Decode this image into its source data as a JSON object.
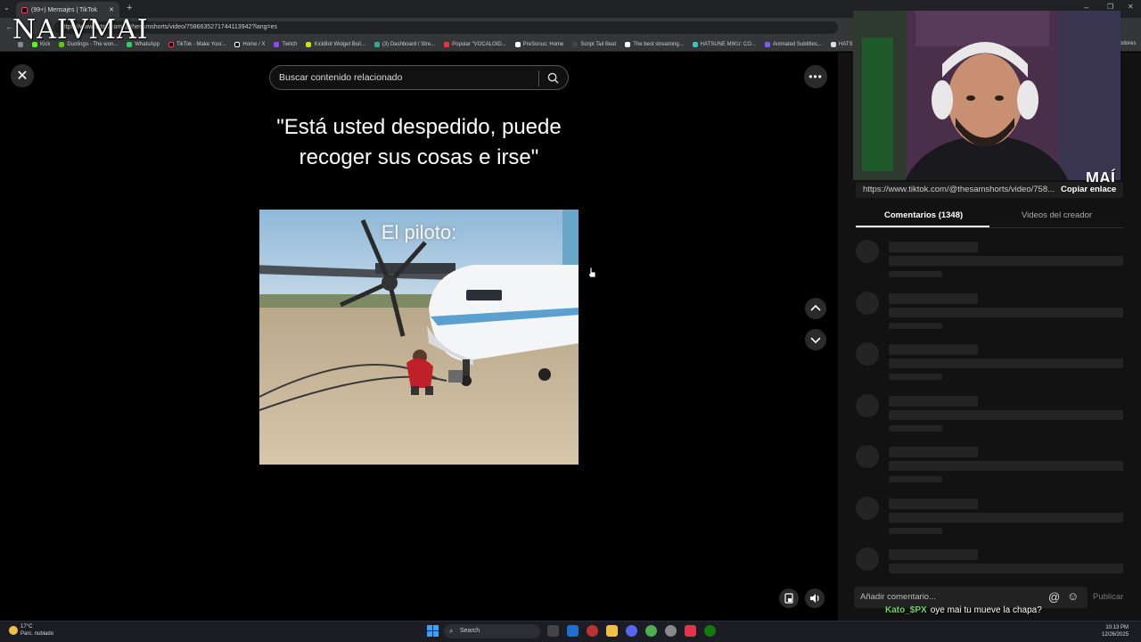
{
  "overlay_logo": "NAIVMAI",
  "browser": {
    "tab_title": "(99+) Mensajes | TikTok",
    "url": "https://www.tiktok.com/@thesamshorts/video/7586635271744113942?lang=es",
    "bookmarks": [
      "Kick",
      "Duolingo - The won...",
      "WhatsApp",
      "TikTok - Make Your...",
      "Home / X",
      "Twitch",
      "KickBot Widget Buil...",
      "(3) Dashboard / Stre...",
      "Popular \"VOCALOID...",
      "PreSonus: Home",
      "Script Tail Beat",
      "The best streaming...",
      "HATSUNE MIKU: CO...",
      "Animated Subtitles...",
      "HATSUN"
    ],
    "bookmarks_overflow": "odores"
  },
  "video": {
    "search_placeholder": "Buscar contenido relacionado",
    "caption": "\"Está usted despedido, puede recoger sus cosas e irse\"",
    "overlay_text": "El piloto:"
  },
  "panel": {
    "cam_logo": "MAÍ",
    "link_url": "https://www.tiktok.com/@thesamshorts/video/758...",
    "copy_link": "Copiar enlace",
    "tabs": [
      "Comentarios (1348)",
      "Videos del creador"
    ],
    "comment_placeholder": "Añadir comentario...",
    "publish": "Publicar"
  },
  "chat": {
    "user": "Kato_$PX",
    "message": "oye mai tu mueve la chapa?"
  },
  "taskbar": {
    "temperature": "17°C",
    "weather": "Parc. nublado",
    "search_label": "Search",
    "time": "10:13 PM",
    "date": "12/26/2025"
  },
  "colors": {
    "chat_user": "#6fd16a",
    "panel_bg": "#121212",
    "skeleton": "#242424"
  }
}
